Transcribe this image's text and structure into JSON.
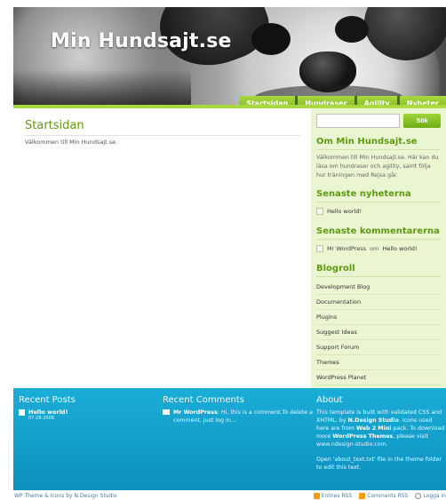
{
  "site": {
    "title": "Min Hundsajt.se"
  },
  "nav": {
    "tabs": [
      {
        "label": "Startsidan"
      },
      {
        "label": "Hundraser"
      },
      {
        "label": "Agility"
      },
      {
        "label": "Nyheter"
      }
    ]
  },
  "main": {
    "title": "Startsidan",
    "body": "Välkommen till Min Hundsajt.se."
  },
  "sidebar": {
    "search": {
      "value": "",
      "button_label": "Sök"
    },
    "about": {
      "heading": "Om Min Hundsajt.se",
      "text": "Välkommen till Min Hundsajt.se. Här kan du läsa om hundraser och agility, samt följa hur träningen med Rejsa går."
    },
    "news": {
      "heading": "Senaste nyheterna",
      "items": [
        {
          "label": "Hello world!"
        }
      ]
    },
    "comments": {
      "heading": "Senaste kommentarerna",
      "items": [
        {
          "author": "Mr WordPress",
          "on": "om",
          "post": "Hello world!"
        }
      ]
    },
    "blogroll": {
      "heading": "Blogroll",
      "items": [
        {
          "label": "Development Blog"
        },
        {
          "label": "Documentation"
        },
        {
          "label": "Plugins"
        },
        {
          "label": "Suggest Ideas"
        },
        {
          "label": "Support Forum"
        },
        {
          "label": "Themes"
        },
        {
          "label": "WordPress Planet"
        }
      ]
    }
  },
  "footer": {
    "recent_posts": {
      "heading": "Recent Posts",
      "items": [
        {
          "title": "Hello world!",
          "date": "07-28-2008"
        }
      ]
    },
    "recent_comments": {
      "heading": "Recent Comments",
      "items": [
        {
          "author": "Mr WordPress",
          "text": ": Hi, this is a comment.To delete a comment, just log in..."
        }
      ]
    },
    "about": {
      "heading": "About",
      "p1_a": "This template is built with validated CSS and XHTML, by ",
      "p1_b": "N.Design Studio",
      "p1_c": ". Icons used here are from ",
      "p1_d": "Web 2 Mini",
      "p1_e": " pack. To download more ",
      "p1_f": "WordPress Themes",
      "p1_g": ", please visit www.ndesign-studio.com.",
      "p2": "Open 'about_text.txt' file in the theme folder to edit this text."
    }
  },
  "bottom_bar": {
    "credit_a": "WP Theme",
    "credit_amp": " & ",
    "credit_b": "Icons",
    "credit_by": " by ",
    "credit_c": "N.Design Studio",
    "entries_rss": "Entries RSS",
    "comments_rss": "Comments RSS",
    "login": "Logga in"
  },
  "colors": {
    "accent_green": "#7cb51a",
    "sidebar_bg": "#e9f6d1",
    "footer_blue": "#129dca"
  }
}
